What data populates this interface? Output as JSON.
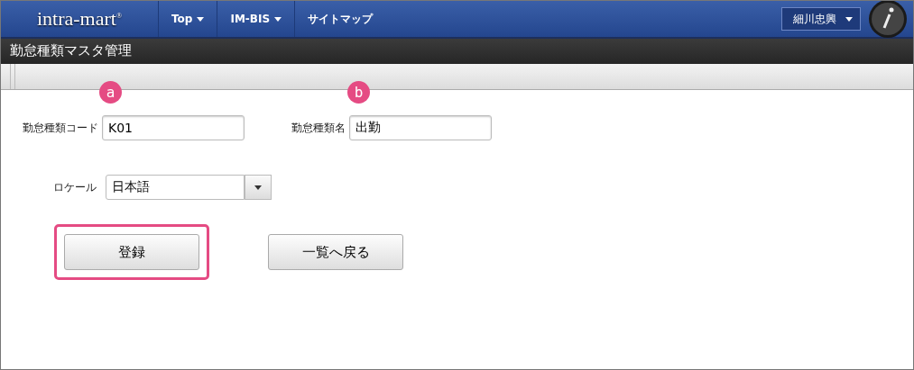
{
  "header": {
    "logo": "intra-mart$^{®}$",
    "nav": [
      {
        "label": "Top",
        "dropdown": true
      },
      {
        "label": "IM-BIS",
        "dropdown": true
      },
      {
        "label": "サイトマップ",
        "dropdown": false
      }
    ],
    "user": "細川忠興"
  },
  "page_title": "勤怠種類マスタ管理",
  "form": {
    "fields": [
      {
        "label": "勤怠種類コード",
        "value": "K01",
        "marker": "a"
      },
      {
        "label": "勤怠種類名",
        "value": "出勤",
        "marker": "b"
      }
    ],
    "locale": {
      "label": "ロケール",
      "value": "日本語"
    }
  },
  "buttons": [
    {
      "label": "登録",
      "highlighted": true
    },
    {
      "label": "一覧へ戻る",
      "highlighted": false
    }
  ]
}
